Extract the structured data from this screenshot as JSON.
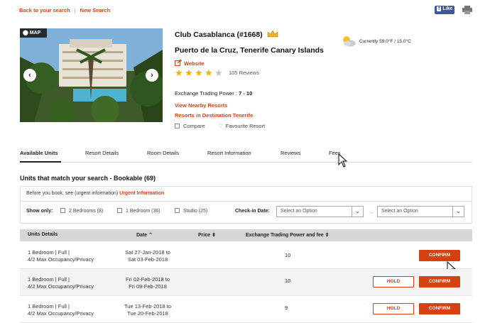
{
  "topnav": {
    "back_label": "Back to your search",
    "new_label": "New Search",
    "fb_label": "Like",
    "fb_f": "f"
  },
  "photo": {
    "map_label": "MAP",
    "prev": "‹",
    "next": "›"
  },
  "resort": {
    "title": "Club Casablanca (#1668)",
    "location": "Puerto de la Cruz, Tenerife  Canary Islands",
    "website_label": "Website",
    "rating": 4,
    "max_rating": 5,
    "reviews_label": "105 Reviews",
    "etp_label": "Exchange Trading Power :",
    "etp_value": "7 - 10",
    "nearby_label": "View Nearby Resorts",
    "dest_label": "Resorts in Destination Tenerife",
    "compare_label": "Compare",
    "favourite_label": "Favourite Resort",
    "weather": "Currently 59.0°F / 15.0°C"
  },
  "tabs": [
    {
      "label": "Available Units",
      "active": true
    },
    {
      "label": "Resort Details",
      "active": false
    },
    {
      "label": "Room Details",
      "active": false
    },
    {
      "label": "Resort Information",
      "active": false
    },
    {
      "label": "Reviews",
      "active": false
    },
    {
      "label": "Fees",
      "active": false
    }
  ],
  "units": {
    "section_title": "Units that match your search - Bookable (69)",
    "urgent_prefix": "Before you book, see (urgent information)",
    "urgent_link": "Urgent Information",
    "show_only_label": "Show only:",
    "options": [
      "2 Bedrooms (8)",
      "1 Bedroom (36)",
      "Studio (25)"
    ],
    "checkin_label": "Check-in Date:",
    "select_placeholder_1": "Select an Option",
    "select_placeholder_2": "Select an Option",
    "arrow": "→"
  },
  "table": {
    "headers": {
      "details": "Units Details",
      "date": "Date",
      "price": "Price",
      "etp": "Exchange Trading Power and fee"
    },
    "rows": [
      {
        "unit_line1": "1  Bedroom | Full |",
        "unit_line2": "4/2 Max Occupancy/Privacy",
        "date_line1": "Sat 27-Jan-2018 to",
        "date_line2": "Sat 03-Feb-2018",
        "etp": "10",
        "hold": false
      },
      {
        "unit_line1": "1  Bedroom | Full |",
        "unit_line2": "4/2 Max Occupancy/Privacy",
        "date_line1": "Fri 02-Feb-2018 to",
        "date_line2": "Fri 09-Feb-2018",
        "etp": "10",
        "hold": true
      },
      {
        "unit_line1": "1  Bedroom | Full |",
        "unit_line2": "4/2 Max Occupancy/Privacy",
        "date_line1": "Tue 13-Feb-2018 to",
        "date_line2": "Tue 20-Feb-2018",
        "etp": "9",
        "hold": true
      }
    ],
    "confirm_label": "CONFIRM",
    "hold_label": "HOLD"
  },
  "colors": {
    "accent": "#d4420f",
    "star": "#f0b400",
    "header_bg": "#d6d6d6"
  }
}
